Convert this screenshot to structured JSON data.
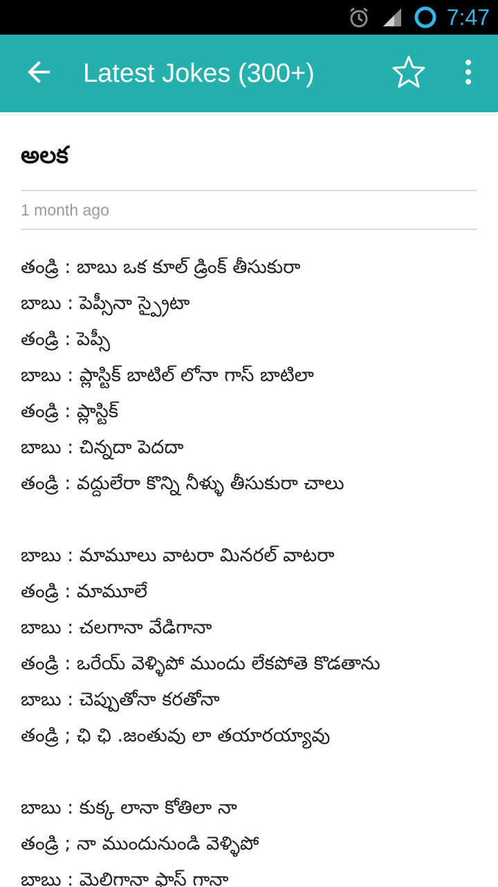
{
  "status_bar": {
    "time": "7:47",
    "icons": [
      "alarm-icon",
      "signal-icon",
      "sync-icon"
    ]
  },
  "app_bar": {
    "back_icon": "arrow-left-icon",
    "title": "Latest Jokes (300+)",
    "favorite_icon": "star-outline-icon",
    "overflow_icon": "more-vertical-icon",
    "color": "#26b0ad"
  },
  "joke": {
    "title": "అలక",
    "posted": "1 month ago",
    "lines": [
      "తండ్రి : బాబు ఒక కూల్ డ్రింక్ తీసుకురా",
      "బాబు : పెప్సీనా స్ప్రైటా",
      "తండ్రి : పెప్సీ",
      "బాబు : ప్లాస్టిక్ బాటిల్ లోనా గాస్ బాటిలా",
      "తండ్రి : ప్లాస్టిక్",
      "బాబు : చిన్నదా పెదదా",
      "తండ్రి : వద్దులేరా కొన్ని నీళ్ళు తీసుకురా చాలు",
      "",
      "బాబు : మామూలు వాటరా మినరల్ వాటరా",
      "తండ్రి : మామూలే",
      "బాబు : చలగానా వేడిగానా",
      "తండ్రి : ఒరేయ్ వెళ్ళిపో ముందు  లేకపోతె కొడతాను",
      "బాబు : చెప్పుతోనా కరతోనా",
      "తండ్రి ; ఛి ఛి .జంతువు లా తయారయ్యావు",
      "",
      "బాబు : కుక్క లానా కోతిలా నా",
      "తండ్రి ; నా ముందునుండి వెళ్ళిపో",
      "బాబు : మెల్లిగానా ఫాస్ గానా"
    ]
  }
}
